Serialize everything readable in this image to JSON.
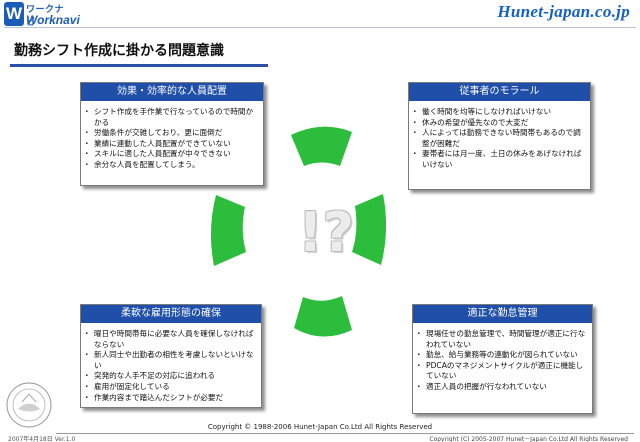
{
  "logo": {
    "mark": "W",
    "top": "ワークナビ",
    "bottom": "Worknavi"
  },
  "brand": "Hunet-japan.co.jp",
  "title": "勤務シフト作成に掛かる問題意識",
  "center_mark": "!?",
  "cards": {
    "top_left": {
      "title": "効果・効率的な人員配置",
      "items": [
        "シフト作成を手作業で行なっているので時間かかる",
        "労働条件が交雑しており、更に面倒だ",
        "業績に連動した人員配置ができていない",
        "スキルに適した人員配置が中々できない",
        "余分な人員を配置してしまう。"
      ]
    },
    "top_right": {
      "title": "従事者のモラール",
      "items": [
        "働く時間を均等にしなければいけない",
        "休みの希望が優先なので大変だ",
        "人によっては勤務できない時間帯もあるので調整が困難だ",
        "妻帯者には月一度、土日の休みをあげなければいけない"
      ]
    },
    "bottom_left": {
      "title": "柔軟な雇用形態の確保",
      "items": [
        "曜日や時間帯毎に必要な人員を確保しなければならない",
        "新人同士や出勤者の相性を考慮しないといけない",
        "突発的な人手不足の対応に追われる",
        "雇用が固定化している",
        "作業内容まで踏込んだシフトが必要だ"
      ]
    },
    "bottom_right": {
      "title": "適正な勤怠管理",
      "items": [
        "現場任せの勤怠管理で、時間管理が適正に行なわれていない",
        "勤怠、給与業務等の連動化が図られていない",
        "PDCAのマネジメントサイクルが適正に機能していない",
        "適正人員の把握が行なわれていない"
      ]
    }
  },
  "footer": {
    "copyright_top": "Copyright © 1988-2006 Hunet-Japan Co.Ltd  All Rights Reserved",
    "copyright_bottom": "Copyright (C) 2005-2007 Hunet－Japan Co.Ltd All Rights Reserved",
    "date": "2007年4月18日 Ver.1.0"
  },
  "colors": {
    "accent": "#1f4fa8",
    "ring": "#2cbd3c",
    "brand": "#1560c8"
  },
  "icons": {
    "seal": "company-seal-icon"
  }
}
